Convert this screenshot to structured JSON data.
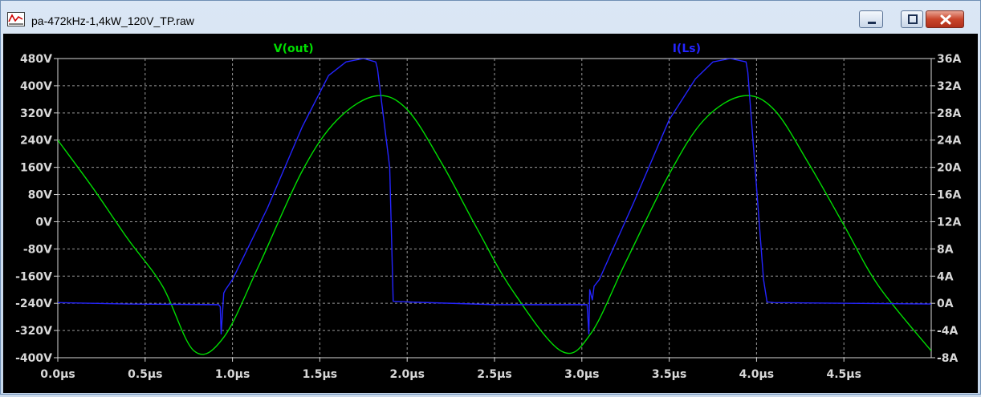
{
  "window": {
    "title": "pa-472kHz-1,4kW_120V_TP.raw",
    "icon": "waveform-chart-icon",
    "controls": [
      "minimize-icon",
      "maximize-icon",
      "close-icon"
    ]
  },
  "colors": {
    "background": "#000000",
    "grid": "#9a9a9a",
    "axis_text": "#d8d8d8",
    "vout": "#00dd00",
    "ils": "#2424ff"
  },
  "chart_data": {
    "type": "line",
    "grid": true,
    "xlim": [
      0,
      5
    ],
    "x_ticks": [
      0,
      0.5,
      1,
      1.5,
      2,
      2.5,
      3,
      3.5,
      4,
      4.5
    ],
    "x_tick_labels": [
      "0.0µs",
      "0.5µs",
      "1.0µs",
      "1.5µs",
      "2.0µs",
      "2.5µs",
      "3.0µs",
      "3.5µs",
      "4.0µs",
      "4.5µs"
    ],
    "y_left": {
      "lim": [
        -400,
        480
      ],
      "ticks": [
        480,
        400,
        320,
        240,
        160,
        80,
        0,
        -80,
        -160,
        -240,
        -320,
        -400
      ],
      "tick_labels": [
        "480V",
        "400V",
        "320V",
        "240V",
        "160V",
        "80V",
        "0V",
        "-80V",
        "-160V",
        "-240V",
        "-320V",
        "-400V"
      ]
    },
    "y_right": {
      "lim": [
        -8,
        36
      ],
      "ticks": [
        36,
        32,
        28,
        24,
        20,
        16,
        12,
        8,
        4,
        0,
        -4,
        -8
      ],
      "tick_labels": [
        "36A",
        "32A",
        "28A",
        "24A",
        "20A",
        "16A",
        "12A",
        "8A",
        "4A",
        "0A",
        "-4A",
        "-8A"
      ]
    },
    "series": [
      {
        "name": "V(out)",
        "axis": "left",
        "x": [
          0.0,
          0.2,
          0.4,
          0.6,
          0.78,
          0.95,
          1.15,
          1.4,
          1.6,
          1.82,
          2.0,
          2.2,
          2.4,
          2.6,
          2.88,
          3.05,
          3.25,
          3.5,
          3.7,
          3.92,
          4.1,
          4.3,
          4.5,
          4.7,
          5.0
        ],
        "y": [
          240,
          100,
          -50,
          -190,
          -380,
          -340,
          -130,
          150,
          300,
          370,
          330,
          170,
          -20,
          -200,
          -380,
          -330,
          -120,
          140,
          300,
          370,
          330,
          170,
          -10,
          -190,
          -380
        ]
      },
      {
        "name": "I(Ls)",
        "axis": "right",
        "x": [
          0.0,
          0.4,
          0.92,
          0.93,
          0.935,
          0.95,
          0.96,
          1.0,
          1.2,
          1.4,
          1.55,
          1.65,
          1.75,
          1.82,
          1.83,
          1.9,
          1.92,
          2.0,
          2.5,
          3.03,
          3.04,
          3.045,
          3.06,
          3.07,
          3.1,
          3.3,
          3.5,
          3.65,
          3.75,
          3.85,
          3.94,
          3.95,
          4.04,
          4.06,
          4.1,
          5.0
        ],
        "y": [
          0.1,
          -0.1,
          -0.2,
          -0.5,
          -4.5,
          1.5,
          2.0,
          3.5,
          14,
          26,
          33.5,
          35.5,
          36,
          35.5,
          34.5,
          20,
          0.3,
          0.2,
          -0.2,
          -0.2,
          -4.5,
          2.0,
          0.5,
          2.5,
          3.5,
          15,
          27,
          33,
          35.5,
          36,
          35.5,
          34.0,
          3.5,
          0.2,
          0.1,
          -0.1
        ]
      }
    ]
  }
}
